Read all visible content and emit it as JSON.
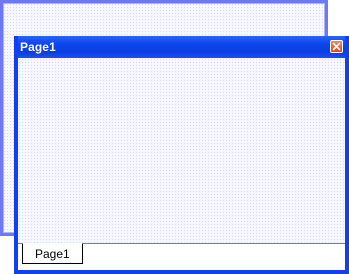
{
  "background_window": {
    "border_color": "#6f78f4"
  },
  "window": {
    "title": "Page1",
    "titlebar_color": "#0a46ee",
    "close_icon": "close-icon",
    "close_color": "#d7471f"
  },
  "tabs": [
    {
      "label": "Page1",
      "active": true
    }
  ]
}
